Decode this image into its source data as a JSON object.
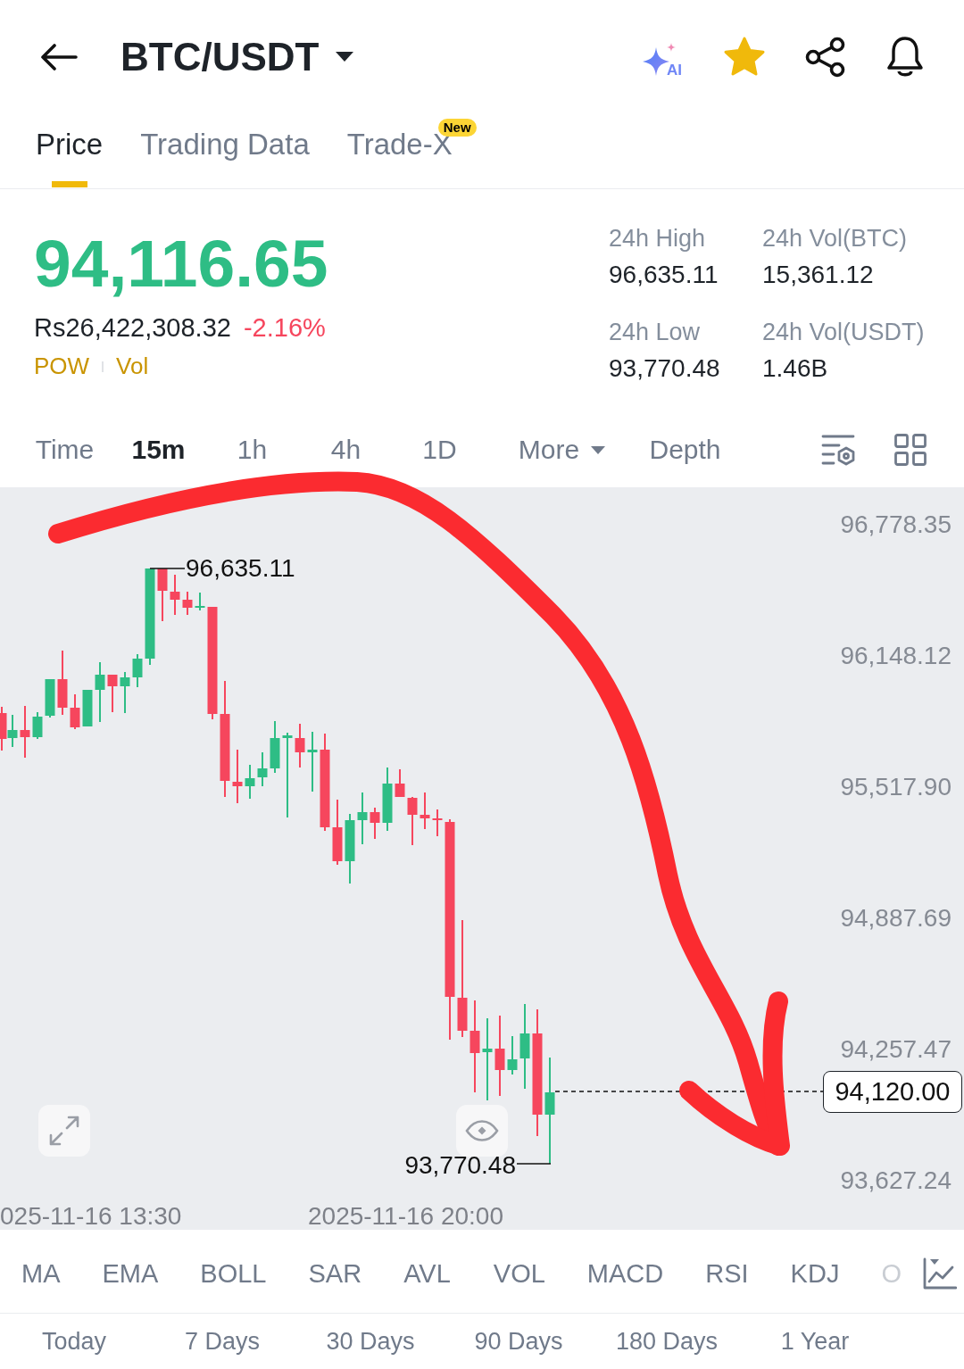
{
  "header": {
    "title": "BTC/USDT",
    "ai_label": "AI",
    "favorite": true
  },
  "tabs": [
    {
      "label": "Price",
      "selected": true
    },
    {
      "label": "Trading Data",
      "selected": false
    },
    {
      "label": "Trade-X",
      "selected": false,
      "badge": "New"
    }
  ],
  "ticker": {
    "last_price": "94,116.65",
    "price_up": true,
    "fiat_price": "Rs26,422,308.32",
    "change": "-2.16%",
    "change_up": false,
    "tags": [
      "POW",
      "Vol"
    ],
    "stats": [
      {
        "label": "24h High",
        "value": "96,635.11"
      },
      {
        "label": "24h Vol(BTC)",
        "value": "15,361.12"
      },
      {
        "label": "24h Low",
        "value": "93,770.48"
      },
      {
        "label": "24h Vol(USDT)",
        "value": "1.46B"
      }
    ]
  },
  "intervals": [
    {
      "label": "Time",
      "selected": false,
      "kind": "tab"
    },
    {
      "label": "15m",
      "selected": true,
      "kind": "tab"
    },
    {
      "label": "1h",
      "selected": false,
      "kind": "tab"
    },
    {
      "label": "4h",
      "selected": false,
      "kind": "tab"
    },
    {
      "label": "1D",
      "selected": false,
      "kind": "tab"
    },
    {
      "label": "More",
      "selected": false,
      "kind": "dropdown"
    },
    {
      "label": "Depth",
      "selected": false,
      "kind": "tab"
    }
  ],
  "chart": {
    "y_axis": [
      "96,778.35",
      "96,148.12",
      "95,517.90",
      "94,887.69",
      "94,257.47",
      "93,627.24"
    ],
    "x_axis": [
      "025-11-16 13:30",
      "2025-11-16 20:00"
    ],
    "high_label": "96,635.11",
    "low_label": "93,770.48",
    "last_price": "94,120.00"
  },
  "indicators": {
    "main": [
      "MA",
      "EMA",
      "BOLL",
      "SAR",
      "AVL"
    ],
    "sub": [
      "VOL",
      "MACD",
      "RSI",
      "KDJ",
      "O"
    ]
  },
  "periods": [
    "Today",
    "7 Days",
    "30 Days",
    "90 Days",
    "180 Days",
    "1 Year"
  ]
}
